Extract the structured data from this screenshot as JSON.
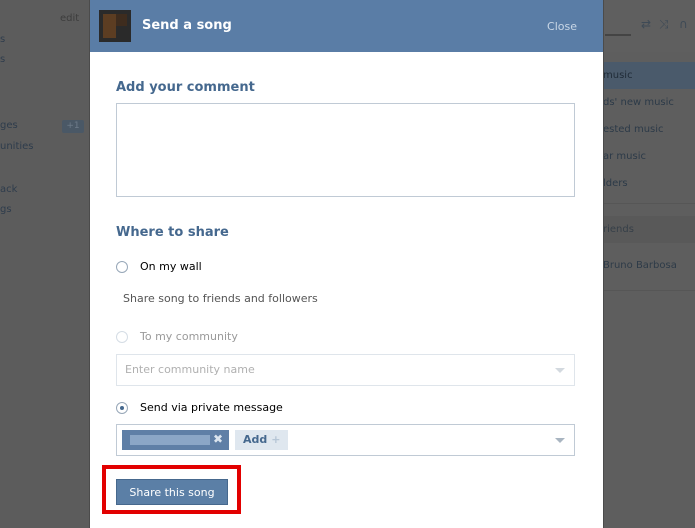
{
  "background": {
    "left_edit": "edit",
    "left_items": [
      "s",
      "s",
      "ges",
      "unities",
      "ack",
      "gs"
    ],
    "left_badge": "+1",
    "right_menu": [
      "music",
      "ds' new music",
      "ested music",
      "ar music",
      "lders"
    ],
    "friends_header": "riends",
    "friend_name": "Bruno Barbosa",
    "player_icons": [
      "⇄",
      "⤨",
      "∩"
    ]
  },
  "modal": {
    "title": "Send a song",
    "close_label": "Close",
    "comment_heading": "Add your comment",
    "comment_value": "",
    "share_heading": "Where to share",
    "options": {
      "wall": "On my wall",
      "wall_hint": "Share song to friends and followers",
      "community": "To my community",
      "community_placeholder": "Enter community name",
      "private": "Send via private message"
    },
    "recipient_token_remove": "✖",
    "add_label": "Add",
    "add_plus": "+",
    "share_button": "Share this song",
    "selected_option": "private"
  },
  "colors": {
    "header": "#5a7da6",
    "accent": "#45688e",
    "highlight": "#e20000"
  }
}
